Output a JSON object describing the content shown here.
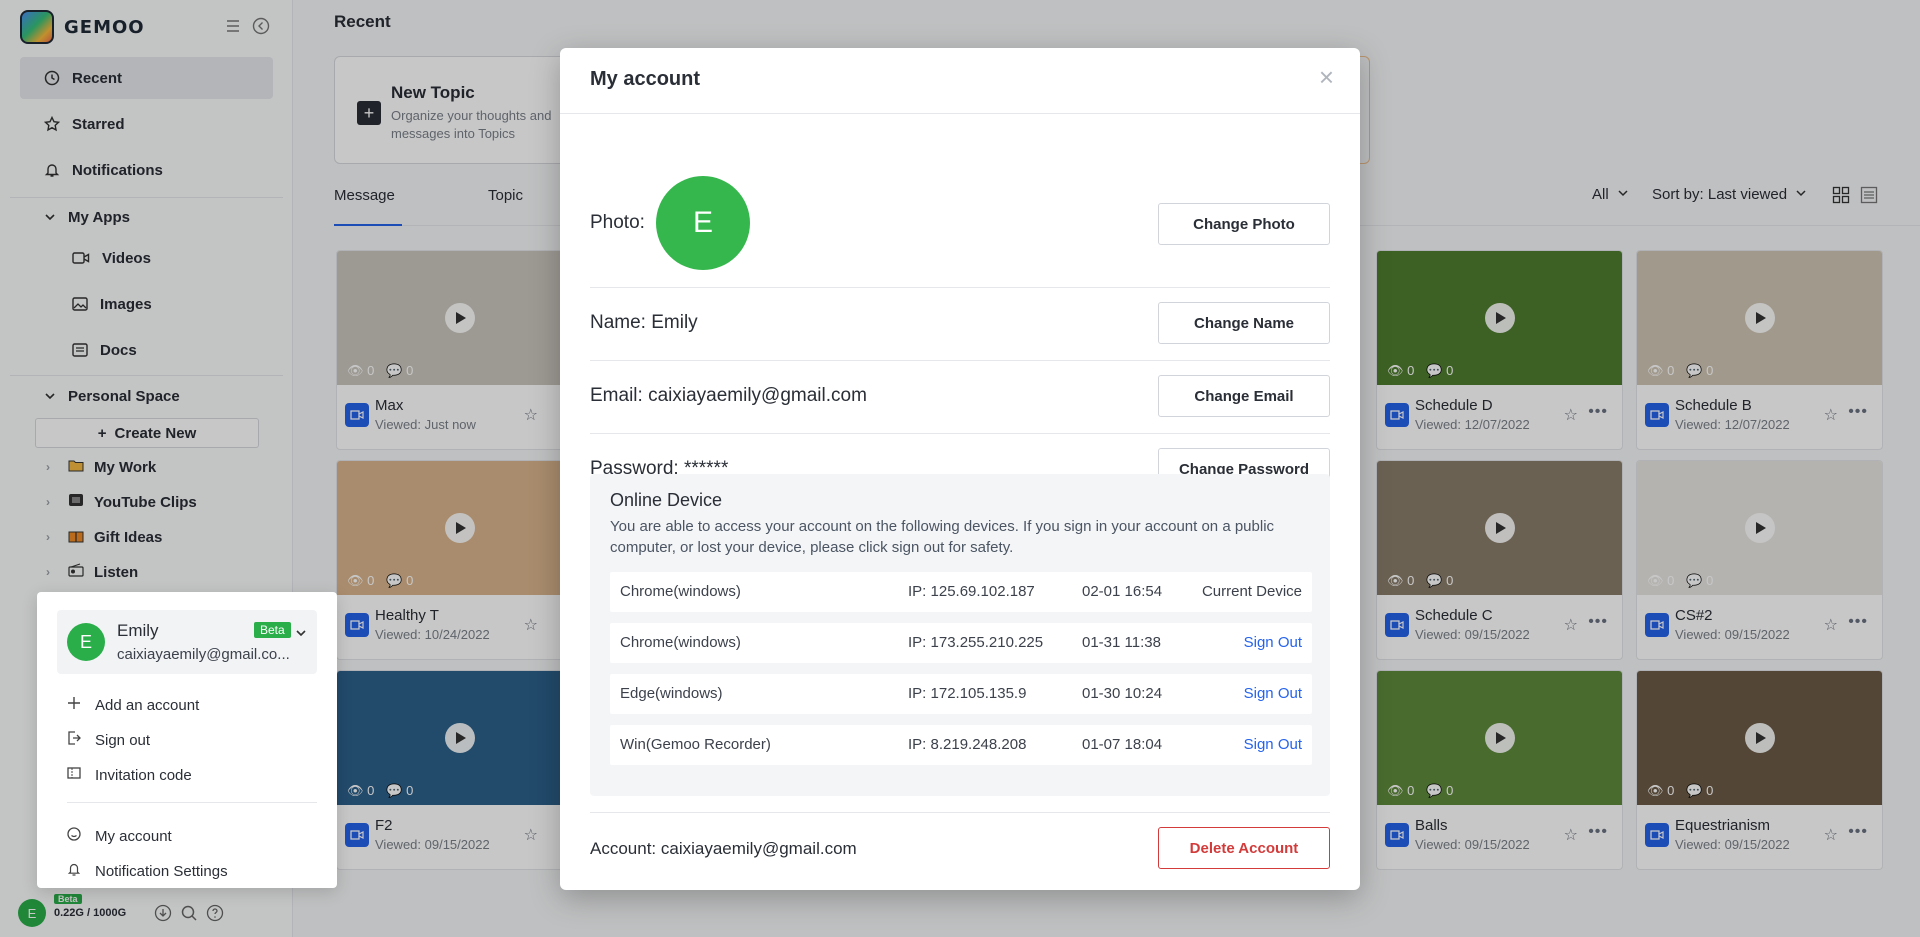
{
  "app": {
    "brand": "GEMOO"
  },
  "sidebar": {
    "recent": "Recent",
    "starred": "Starred",
    "notifications": "Notifications",
    "my_apps": "My Apps",
    "apps": [
      "Videos",
      "Images",
      "Docs"
    ],
    "personal_space": "Personal Space",
    "create_new": "Create New",
    "folders": [
      "My Work",
      "YouTube Clips",
      "Gift Ideas",
      "Listen"
    ],
    "storage": "0.22G / 1000G",
    "beta": "Beta",
    "avatar_letter": "E"
  },
  "account_menu": {
    "name": "Emily",
    "email": "caixiayaemily@gmail.co...",
    "beta": "Beta",
    "avatar_letter": "E",
    "items": [
      "Add an account",
      "Sign out",
      "Invitation code",
      "My account",
      "Notification Settings"
    ]
  },
  "main": {
    "title": "Recent",
    "new_topic": {
      "title": "New Topic",
      "desc": "Organize your thoughts and messages into Topics"
    },
    "tabs": [
      "Message",
      "Topic"
    ],
    "filter_all": "All",
    "sort_label": "Sort by: Last viewed",
    "cards": [
      {
        "name": "Max",
        "viewed": "Viewed: Just now",
        "views": "0",
        "comments": "0",
        "color": "#c9c4bd"
      },
      {
        "name": "Healthy T",
        "viewed": "Viewed: 10/24/2022",
        "views": "0",
        "comments": "0",
        "color": "#d9b48c"
      },
      {
        "name": "F2",
        "viewed": "Viewed: 09/15/2022",
        "views": "0",
        "comments": "0",
        "color": "#2c5f8a"
      },
      {
        "name": "Schedule D",
        "viewed": "Viewed: 12/07/2022",
        "views": "0",
        "comments": "0",
        "color": "#4f7d2f"
      },
      {
        "name": "Schedule B",
        "viewed": "Viewed: 12/07/2022",
        "views": "0",
        "comments": "0",
        "color": "#cfc4b4"
      },
      {
        "name": "Schedule C",
        "viewed": "Viewed: 09/15/2022",
        "views": "0",
        "comments": "0",
        "color": "#8a7d6b"
      },
      {
        "name": "CS#2",
        "viewed": "Viewed: 09/15/2022",
        "views": "0",
        "comments": "0",
        "color": "#e8e6e2"
      },
      {
        "name": "Balls",
        "viewed": "Viewed: 09/15/2022",
        "views": "0",
        "comments": "0",
        "color": "#5e8a3c"
      },
      {
        "name": "Equestrianism",
        "viewed": "Viewed: 09/15/2022",
        "views": "0",
        "comments": "0",
        "color": "#6b5a46"
      }
    ]
  },
  "modal": {
    "title": "My account",
    "photo_label": "Photo:",
    "avatar_letter": "E",
    "change_photo": "Change Photo",
    "name_label": "Name: Emily",
    "change_name": "Change Name",
    "email_label": "Email: caixiayaemily@gmail.com",
    "change_email": "Change Email",
    "password_label": "Password: ******",
    "change_password": "Change Password",
    "online_device": {
      "title": "Online Device",
      "desc": "You are able to access your account on the following devices. If you sign in your account on a public computer, or lost your device, please click sign out for safety.",
      "devices": [
        {
          "name": "Chrome(windows)",
          "ip": "IP: 125.69.102.187",
          "time": "02-01 16:54",
          "action": "Current Device"
        },
        {
          "name": "Chrome(windows)",
          "ip": "IP: 173.255.210.225",
          "time": "01-31 11:38",
          "action": "Sign Out"
        },
        {
          "name": "Edge(windows)",
          "ip": "IP: 172.105.135.9",
          "time": "01-30 10:24",
          "action": "Sign Out"
        },
        {
          "name": "Win(Gemoo Recorder)",
          "ip": "IP: 8.219.248.208",
          "time": "01-07 18:04",
          "action": "Sign Out"
        }
      ]
    },
    "account_label": "Account: caixiayaemily@gmail.com",
    "delete_account": "Delete Account"
  }
}
